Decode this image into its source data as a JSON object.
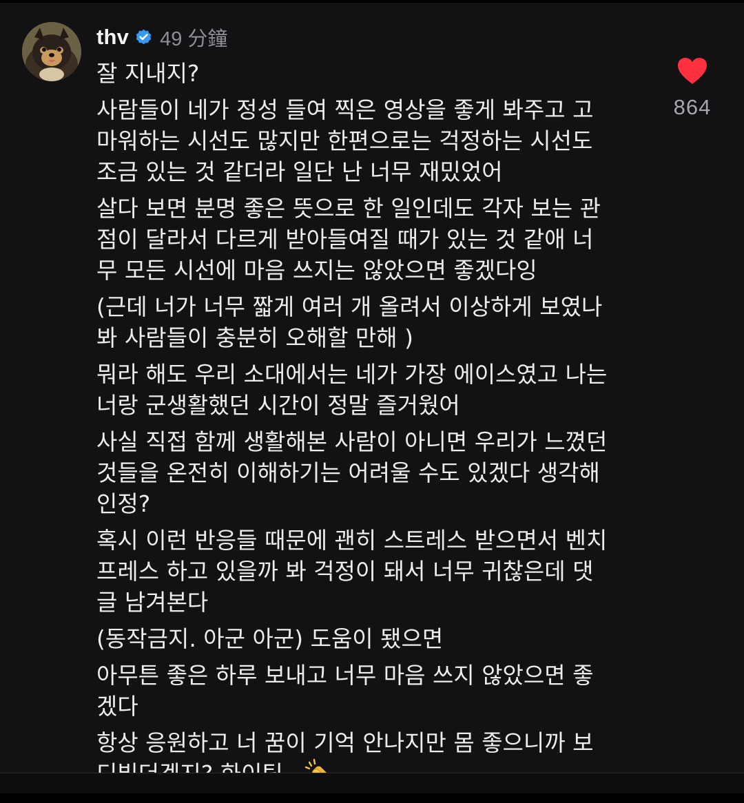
{
  "comment": {
    "username": "thv",
    "verified": true,
    "timestamp": "49 分鐘",
    "avatar": "dog-avatar",
    "likes": "864",
    "liked": true,
    "paragraphs": [
      [
        "잘 지내지?"
      ],
      [
        "사람들이 네가 정성 들여 찍은 영상을 좋게 봐주고 고",
        "마워하는 시선도 많지만 한편으로는 걱정하는 시선도",
        "조금 있는 것 같더라 일단 난 너무 재밌었어"
      ],
      [
        "살다 보면 분명 좋은 뜻으로 한 일인데도 각자 보는 관",
        "점이 달라서 다르게 받아들여질 때가 있는 것 같애 너",
        "무 모든 시선에 마음 쓰지는 않았으면 좋겠다잉"
      ],
      [
        "(근데 너가 너무 짧게 여러 개 올려서 이상하게 보였나",
        "봐 사람들이 충분히 오해할 만해 )"
      ],
      [
        "뭐라 해도 우리 소대에서는 네가 가장 에이스였고 나는",
        "너랑 군생활했던 시간이 정말 즐거웠어"
      ],
      [
        "사실 직접 함께 생활해본 사람이 아니면 우리가 느꼈던",
        "것들을 온전히 이해하기는 어려울 수도 있겠다 생각해",
        "인정?"
      ],
      [
        "혹시 이런 반응들 때문에 괜히 스트레스 받으면서 벤치",
        "프레스 하고 있을까 봐 걱정이 돼서 너무 귀찮은데 댓",
        "글 남겨본다"
      ],
      [
        "(동작금지. 아군 아군) 도움이 됐으면"
      ],
      [
        "아무튼 좋은 하루 보내고 너무 마음 쓰지 않았으면 좋",
        "겠다"
      ],
      [
        "항상 응원하고 너 꿈이 기억 안나지만 몸 좋으니까 보",
        "디빌더겠지? 화이팅~"
      ]
    ],
    "trailing_emoji": "clapping-hands-emoji"
  },
  "colors": {
    "background": "#121214",
    "text": "#ededed",
    "muted": "#8e8e93",
    "verified_blue": "#3897f0",
    "heart_red": "#ff3040"
  }
}
